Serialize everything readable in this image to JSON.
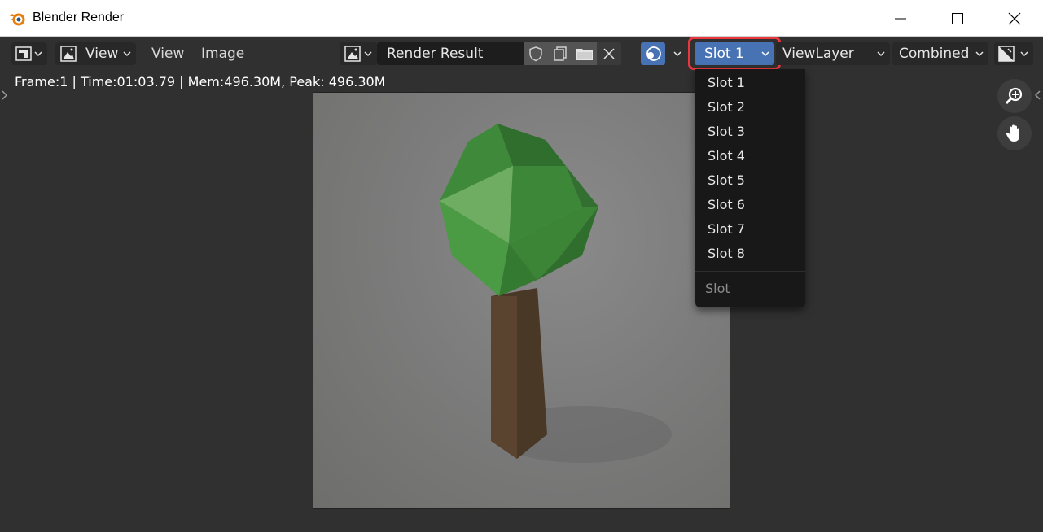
{
  "window": {
    "title": "Blender Render",
    "icon": "blender-logo-icon"
  },
  "header": {
    "editor_type_icon": "image-editor-icon",
    "view_mode_label": "View",
    "menus": [
      "View",
      "Image"
    ],
    "image_browse_icon": "image-browse-icon",
    "image_name": "Render Result",
    "image_actions": [
      "fake-user-shield-icon",
      "duplicate-icon",
      "open-folder-icon",
      "close-icon"
    ],
    "display_channel_icon": "display-channels-icon",
    "slot_selected": "Slot 1",
    "view_layer": "ViewLayer",
    "pass": "Combined",
    "display_mode_icon": "display-mode-icon"
  },
  "status": "Frame:1 | Time:01:03.79 | Mem:496.30M, Peak: 496.30M",
  "slot_menu": {
    "items": [
      "Slot 1",
      "Slot 2",
      "Slot 3",
      "Slot 4",
      "Slot 5",
      "Slot 6",
      "Slot 7",
      "Slot 8"
    ],
    "title": "Slot"
  },
  "navigation": [
    "zoom-icon",
    "pan-hand-icon"
  ],
  "colors": {
    "accent": "#4772b3",
    "highlight": "#e8373d",
    "background": "#303030",
    "menu_bg": "#181818"
  }
}
